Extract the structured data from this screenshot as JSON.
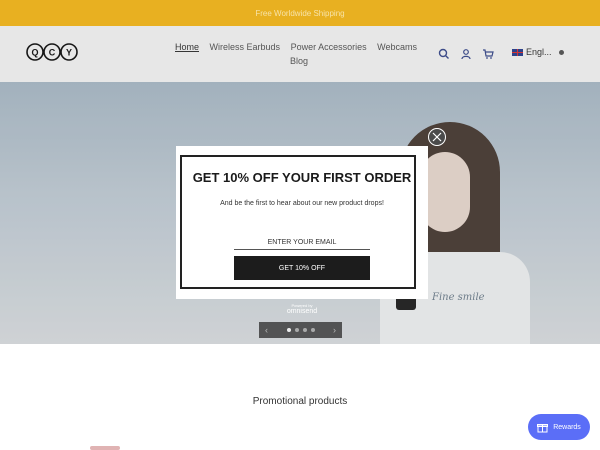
{
  "announcement": {
    "text": "Free Worldwide Shipping"
  },
  "header": {
    "logo_text": "QCY",
    "nav": [
      {
        "label": "Home",
        "active": true
      },
      {
        "label": "Wireless Earbuds",
        "active": false
      },
      {
        "label": "Power Accessories",
        "active": false
      },
      {
        "label": "Webcams",
        "active": false
      }
    ],
    "nav_blog": "Blog",
    "icons": [
      "search-icon",
      "account-icon",
      "cart-icon"
    ],
    "language": "Engl..."
  },
  "hero": {
    "signature": "Fine smile",
    "slider": {
      "prev": "‹",
      "next": "›",
      "slides": 4,
      "current": 1
    }
  },
  "popup": {
    "title": "GET 10% OFF YOUR FIRST ORDER",
    "subtitle": "And be the first to hear about our new product drops!",
    "email_placeholder": "ENTER YOUR EMAIL",
    "cta_label": "GET 10% OFF",
    "powered_label": "Powered by",
    "powered_brand": "omnisend"
  },
  "section": {
    "title": "Promotional products"
  },
  "rewards": {
    "label": "Rewards"
  },
  "colors": {
    "announcement": "#e8b021",
    "rewards": "#5b6ef7",
    "cta": "#1c1c1c"
  }
}
